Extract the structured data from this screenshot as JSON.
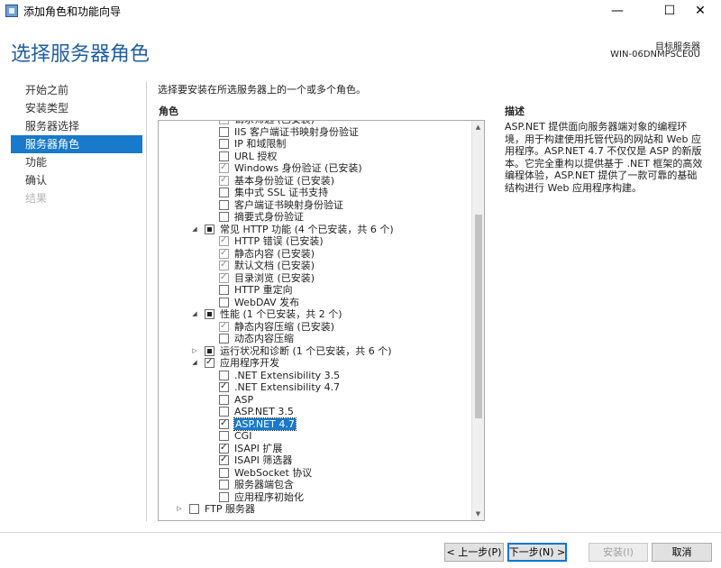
{
  "window": {
    "title": "添加角色和功能向导",
    "minimize": "—",
    "maximize": "☐",
    "close": "✕"
  },
  "header": {
    "title": "选择服务器角色",
    "target_label": "目标服务器",
    "target_server": "WIN-06DNMPSCE0U"
  },
  "nav": {
    "items": [
      {
        "label": "开始之前",
        "state": "normal"
      },
      {
        "label": "安装类型",
        "state": "normal"
      },
      {
        "label": "服务器选择",
        "state": "normal"
      },
      {
        "label": "服务器角色",
        "state": "active"
      },
      {
        "label": "功能",
        "state": "normal"
      },
      {
        "label": "确认",
        "state": "normal"
      },
      {
        "label": "结果",
        "state": "disabled"
      }
    ]
  },
  "main": {
    "instruction": "选择要安装在所选服务器上的一个或多个角色。",
    "roles_label": "角色",
    "description_label": "描述",
    "description": "ASP.NET 提供面向服务器端对象的编程环境，用于构建使用托管代码的网站和 Web 应用程序。ASP.NET 4.7 不仅仅是 ASP 的新版本。它完全重构以提供基于 .NET 框架的高效编程体验，ASP.NET 提供了一款可靠的基础结构进行 Web 应用程序构建。"
  },
  "tree": [
    {
      "label": "请求筛选 (已安装)",
      "level": 2,
      "check": "installed"
    },
    {
      "label": "IIS 客户端证书映射身份验证",
      "level": 2,
      "check": "none"
    },
    {
      "label": "IP 和域限制",
      "level": 2,
      "check": "none"
    },
    {
      "label": "URL 授权",
      "level": 2,
      "check": "none"
    },
    {
      "label": "Windows 身份验证 (已安装)",
      "level": 2,
      "check": "installed"
    },
    {
      "label": "基本身份验证 (已安装)",
      "level": 2,
      "check": "installed"
    },
    {
      "label": "集中式 SSL 证书支持",
      "level": 2,
      "check": "none"
    },
    {
      "label": "客户端证书映射身份验证",
      "level": 2,
      "check": "none"
    },
    {
      "label": "摘要式身份验证",
      "level": 2,
      "check": "none"
    },
    {
      "label": "常见 HTTP 功能 (4 个已安装，共 6 个)",
      "level": 1,
      "check": "partial",
      "expander": "expanded"
    },
    {
      "label": "HTTP 错误 (已安装)",
      "level": 2,
      "check": "installed"
    },
    {
      "label": "静态内容 (已安装)",
      "level": 2,
      "check": "installed"
    },
    {
      "label": "默认文档 (已安装)",
      "level": 2,
      "check": "installed"
    },
    {
      "label": "目录浏览 (已安装)",
      "level": 2,
      "check": "installed"
    },
    {
      "label": "HTTP 重定向",
      "level": 2,
      "check": "none"
    },
    {
      "label": "WebDAV 发布",
      "level": 2,
      "check": "none"
    },
    {
      "label": "性能 (1 个已安装，共 2 个)",
      "level": 1,
      "check": "partial",
      "expander": "expanded"
    },
    {
      "label": "静态内容压缩 (已安装)",
      "level": 2,
      "check": "installed"
    },
    {
      "label": "动态内容压缩",
      "level": 2,
      "check": "none"
    },
    {
      "label": "运行状况和诊断 (1 个已安装，共 6 个)",
      "level": 1,
      "check": "partial",
      "expander": "collapsed"
    },
    {
      "label": "应用程序开发",
      "level": 1,
      "check": "checked",
      "expander": "expanded"
    },
    {
      "label": ".NET Extensibility 3.5",
      "level": 2,
      "check": "none"
    },
    {
      "label": ".NET Extensibility 4.7",
      "level": 2,
      "check": "checked"
    },
    {
      "label": "ASP",
      "level": 2,
      "check": "none"
    },
    {
      "label": "ASP.NET 3.5",
      "level": 2,
      "check": "none"
    },
    {
      "label": "ASP.NET 4.7",
      "level": 2,
      "check": "checked",
      "selected": true
    },
    {
      "label": "CGI",
      "level": 2,
      "check": "none"
    },
    {
      "label": "ISAPI 扩展",
      "level": 2,
      "check": "checked"
    },
    {
      "label": "ISAPI 筛选器",
      "level": 2,
      "check": "checked"
    },
    {
      "label": "WebSocket 协议",
      "level": 2,
      "check": "none"
    },
    {
      "label": "服务器端包含",
      "level": 2,
      "check": "none"
    },
    {
      "label": "应用程序初始化",
      "level": 2,
      "check": "none"
    },
    {
      "label": "FTP 服务器",
      "level": 0,
      "check": "none",
      "expander": "collapsed"
    }
  ],
  "buttons": {
    "prev": "< 上一步(P)",
    "next": "下一步(N) >",
    "install": "安装(I)",
    "cancel": "取消"
  }
}
